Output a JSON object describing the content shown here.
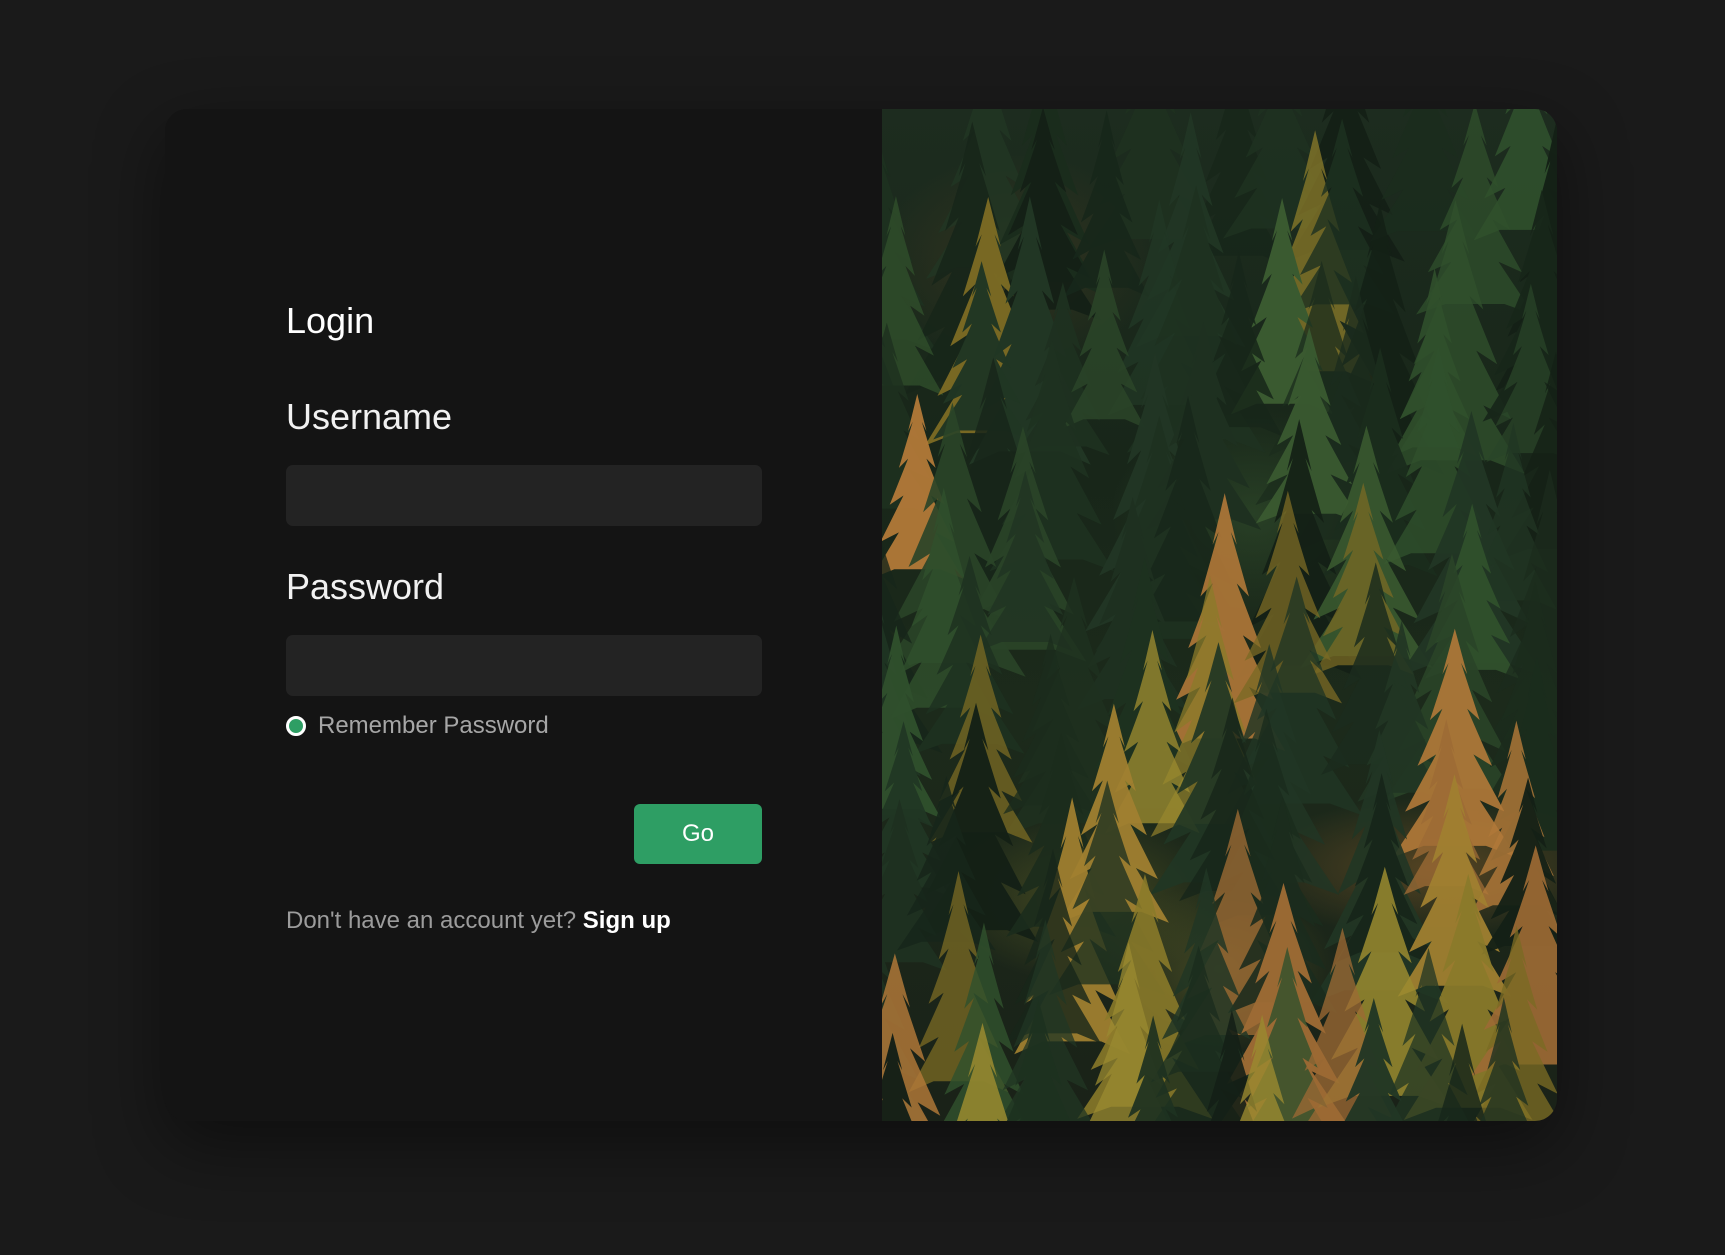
{
  "login": {
    "title": "Login",
    "username_label": "Username",
    "username_value": "",
    "password_label": "Password",
    "password_value": "",
    "remember_label": "Remember Password",
    "remember_checked": true,
    "submit_label": "Go",
    "signup_prompt": "Don't have an account yet?",
    "signup_link": "Sign up"
  },
  "hero_image": {
    "subject": "aerial view of a conifer forest with autumn larches"
  },
  "colors": {
    "page_background": "#1a1a1a",
    "card_background": "#141414",
    "input_background": "#232323",
    "accent": "#2e9e64"
  }
}
